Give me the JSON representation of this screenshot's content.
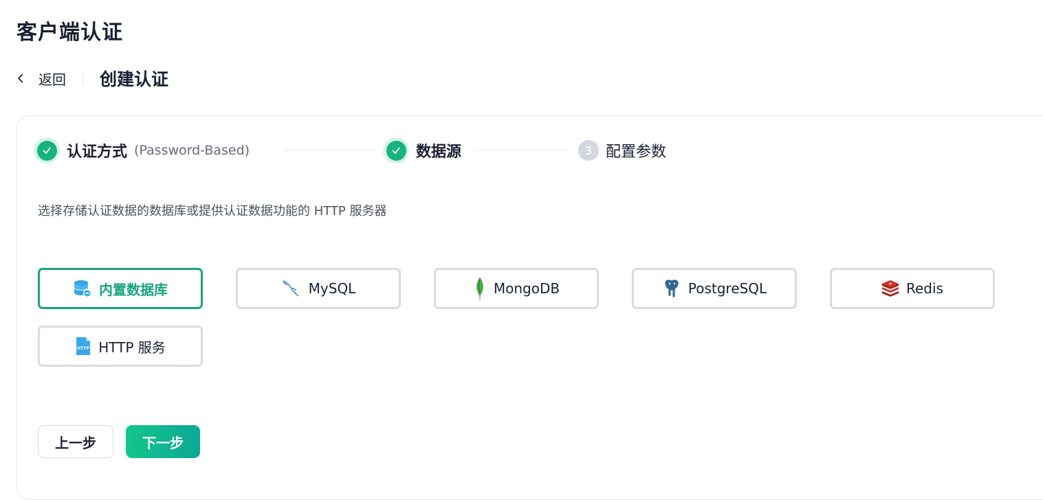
{
  "page": {
    "title": "客户端认证"
  },
  "subheader": {
    "back_label": "返回",
    "title": "创建认证"
  },
  "steps": [
    {
      "label": "认证方式",
      "extra": "(Password-Based)",
      "status": "done"
    },
    {
      "label": "数据源",
      "status": "done"
    },
    {
      "number": "3",
      "label": "配置参数",
      "status": "pending"
    }
  ],
  "description": "选择存储认证数据的数据库或提供认证数据功能的 HTTP 服务器",
  "options": [
    {
      "label": "内置数据库",
      "icon": "database-icon",
      "selected": true
    },
    {
      "label": "MySQL",
      "icon": "mysql-dolphin-icon",
      "selected": false
    },
    {
      "label": "MongoDB",
      "icon": "mongodb-leaf-icon",
      "selected": false
    },
    {
      "label": "PostgreSQL",
      "icon": "postgresql-elephant-icon",
      "selected": false
    },
    {
      "label": "Redis",
      "icon": "redis-icon",
      "selected": false
    },
    {
      "label": "HTTP 服务",
      "icon": "http-file-icon",
      "selected": false
    }
  ],
  "buttons": {
    "prev_label": "上一步",
    "next_label": "下一步"
  },
  "colors": {
    "accent": "#16a57a",
    "step_done": "#17b37f",
    "border": "#d8dbe2"
  }
}
